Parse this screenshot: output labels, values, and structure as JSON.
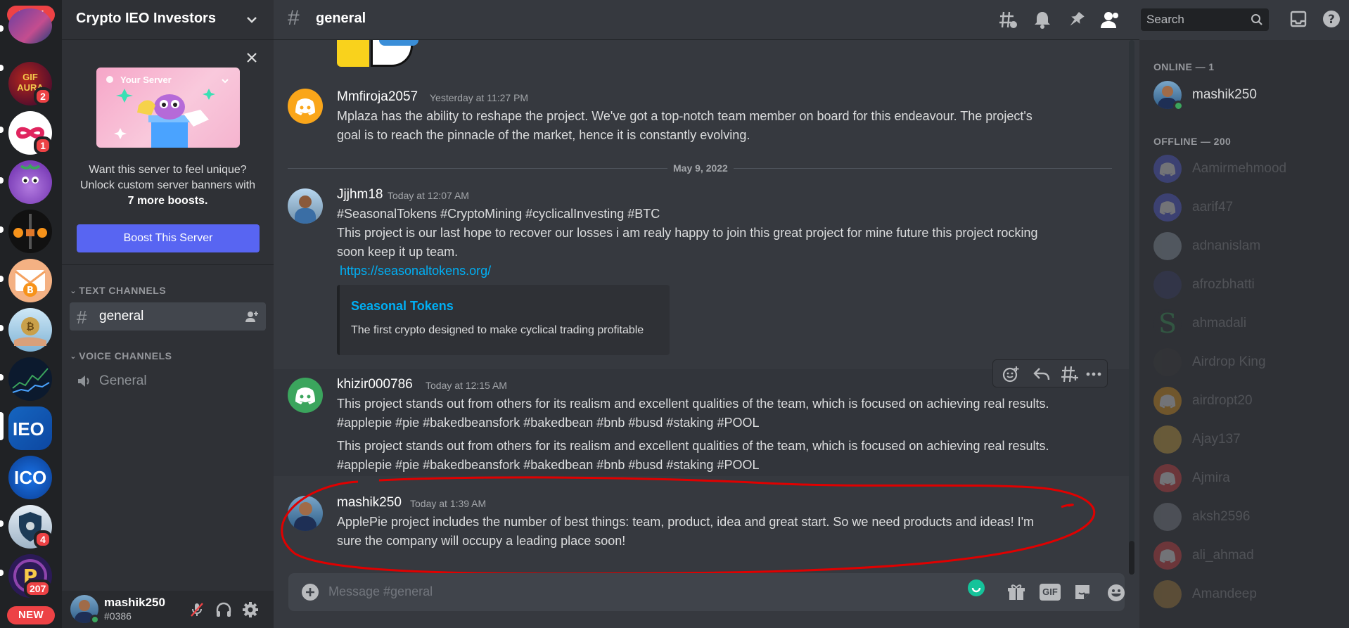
{
  "server": {
    "name": "Crypto IEO Investors",
    "new_label": "NEW",
    "servers": [
      {
        "name": "server-1",
        "badge": ""
      },
      {
        "name": "gif-aura-server",
        "icon_text": "GIF AURA",
        "badge": "2"
      },
      {
        "name": "server-infinity",
        "badge": "1"
      },
      {
        "name": "server-purple-monster",
        "badge": ""
      },
      {
        "name": "server-crypto-coins",
        "badge": ""
      },
      {
        "name": "server-envelope-bitcoin",
        "badge": ""
      },
      {
        "name": "server-bitcoin-hand",
        "badge": ""
      },
      {
        "name": "server-chart",
        "badge": ""
      },
      {
        "name": "server-ieo",
        "icon_text": "IEO",
        "badge": ""
      },
      {
        "name": "server-ico",
        "icon_text": "ICO",
        "badge": ""
      },
      {
        "name": "server-shield",
        "badge": "4"
      },
      {
        "name": "server-pi",
        "badge": "207"
      }
    ]
  },
  "boost": {
    "card_title": "Your Server",
    "line1": "Want this server to feel unique?",
    "line2": "Unlock custom server banners with",
    "line3": "7 more boosts.",
    "button": "Boost This Server"
  },
  "channels": {
    "text_category": "TEXT CHANNELS",
    "voice_category": "VOICE CHANNELS",
    "text": [
      {
        "name": "general"
      }
    ],
    "voice": [
      {
        "name": "General"
      }
    ]
  },
  "user": {
    "name": "mashik250",
    "tag": "#0386"
  },
  "header": {
    "channel": "general",
    "search_placeholder": "Search"
  },
  "messages": [
    {
      "author": "Mmfiroja2057",
      "timestamp": "Yesterday at 11:27 PM",
      "lines": [
        "Mplaza has the ability to reshape the project. We've got a top-notch team member on board for this endeavour. The project's",
        "goal is to reach the pinnacle of the market, hence it is constantly evolving."
      ]
    },
    {
      "divider": "May 9, 2022"
    },
    {
      "author": "Jjjhm18",
      "timestamp": "Today at 12:07 AM",
      "lines": [
        "#SeasonalTokens #CryptoMining #cyclicalInvesting #BTC",
        "This project is our last hope to recover our losses i am realy happy to join this great project for mine future this project rocking",
        "soon keep it up team."
      ],
      "link": "https://seasonaltokens.org/",
      "embed_title": "Seasonal Tokens",
      "embed_desc": "The first crypto designed to make cyclical trading profitable"
    },
    {
      "author": "khizir000786",
      "timestamp": "Today at 12:15 AM",
      "lines": [
        "This project stands out from others for its realism and excellent qualities of the team, which is focused on achieving real results.",
        "#applepie #pie #bakedbeansfork #bakedbean #bnb #busd #staking #POOL"
      ],
      "lines2": [
        "This project stands out from others for its realism and excellent qualities of the team, which is focused on achieving real results.",
        "#applepie #pie #bakedbeansfork #bakedbean #bnb #busd #staking #POOL"
      ]
    },
    {
      "author": "mashik250",
      "timestamp": "Today at 1:39 AM",
      "lines": [
        "ApplePie project includes the number of best things: team, product, idea and great start. So we need products and ideas! I'm",
        "sure the company will occupy a leading place soon!"
      ]
    }
  ],
  "composer": {
    "placeholder": "Message #general",
    "gif_label": "GIF"
  },
  "members": {
    "online_header": "ONLINE — 1",
    "offline_header": "OFFLINE — 200",
    "online": [
      {
        "name": "mashik250"
      }
    ],
    "offline": [
      {
        "name": "Aamirmehmood",
        "color": "#5865f2"
      },
      {
        "name": "aarif47",
        "color": "#5865f2"
      },
      {
        "name": "adnanislam",
        "color": "#9aa7b5"
      },
      {
        "name": "afrozbhatti",
        "color": "#3b3f6e"
      },
      {
        "name": "ahmadali",
        "color": "#2f3136"
      },
      {
        "name": "Airdrop King",
        "color": "#3a3a3a"
      },
      {
        "name": "airdropt20",
        "color": "#faa61a"
      },
      {
        "name": "Ajay137",
        "color": "#e0b040"
      },
      {
        "name": "Ajmira",
        "color": "#ed4245"
      },
      {
        "name": "aksh2596",
        "color": "#8a8f99"
      },
      {
        "name": "ali_ahmad",
        "color": "#ed4245"
      },
      {
        "name": "Amandeep",
        "color": "#b88a3a"
      }
    ]
  },
  "colors": {
    "accent": "#5865f2",
    "link": "#00aff4",
    "online": "#3ba55d",
    "annotation": "#e00000"
  }
}
